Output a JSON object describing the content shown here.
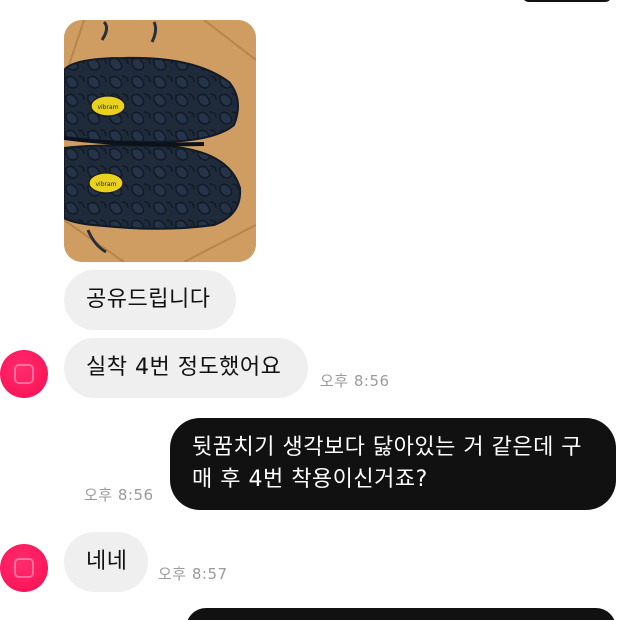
{
  "messages": [
    {
      "id": "photo",
      "type": "image",
      "alt_icon": "photo-icon",
      "logo_text": "vibram"
    },
    {
      "id": "m1",
      "direction": "incoming",
      "text": "공유드립니다"
    },
    {
      "id": "m2",
      "direction": "incoming",
      "text": "실착 4번 정도했어요",
      "time": "오후 8:56"
    },
    {
      "id": "m3",
      "direction": "outgoing",
      "line1": "뒷꿈치기 생각보다 닳아있는 거 같은데 구",
      "line2": "매 후 4번 착용이신거죠?",
      "time": "오후 8:56"
    },
    {
      "id": "m4",
      "direction": "incoming",
      "text": "네네",
      "time": "오후 8:57"
    }
  ],
  "colors": {
    "incoming_bubble": "#efefef",
    "outgoing_bubble": "#111111",
    "avatar": "#ff1a5e",
    "timestamp": "#9a9a9a"
  }
}
